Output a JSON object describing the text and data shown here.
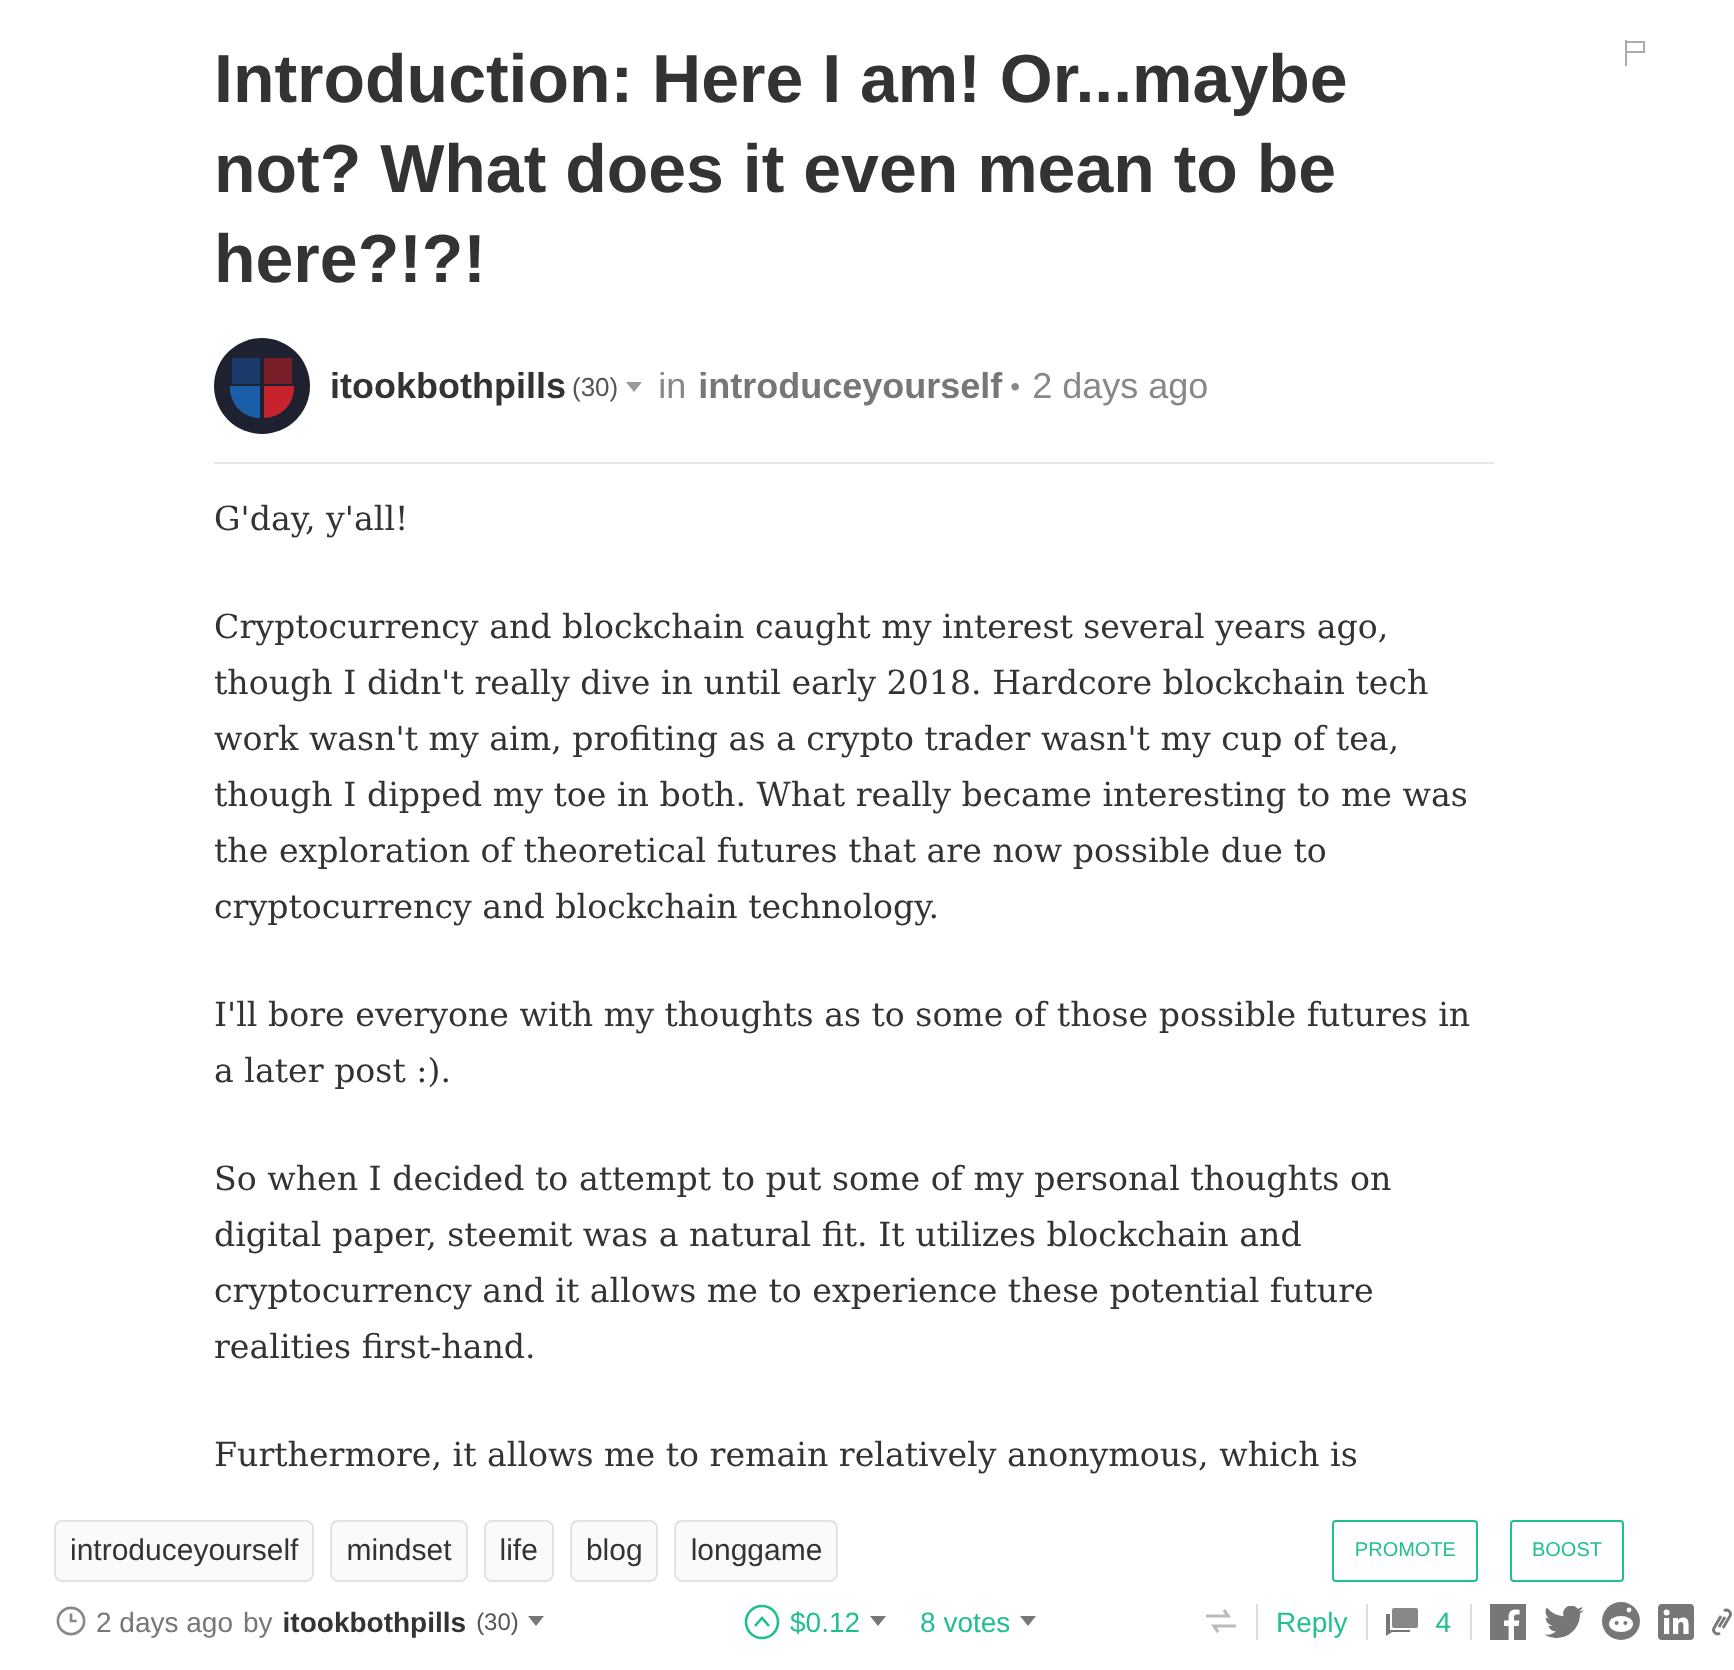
{
  "post": {
    "title": "Introduction: Here I am! Or...maybe not? What does it even mean to be here?!?!",
    "author": {
      "name": "itookbothpills",
      "reputation": "(30)"
    },
    "in_label": "in",
    "community": "introduceyourself",
    "separator": "•",
    "time": "2 days ago",
    "paragraphs": [
      {
        "text": "G'day, y'all!"
      },
      {
        "text": "Cryptocurrency and blockchain caught my interest several years ago, though I didn't really dive in until early 2018. Hardcore blockchain tech work wasn't my aim, profiting as a crypto trader wasn't my cup of tea, though I dipped my toe in both. What really became interesting to me was the exploration of theoretical futures that are now possible due to cryptocurrency and blockchain technology."
      },
      {
        "text": "I'll bore everyone with my thoughts as to some of those possible futures in a later post :)."
      },
      {
        "text": "So when I decided to attempt to put some of my personal thoughts on digital paper, steemit was a natural fit. It utilizes blockchain and cryptocurrency and it allows me to experience these potential future realities first-hand."
      },
      {
        "text": "Furthermore, it allows me to remain relatively anonymous, which is"
      }
    ]
  },
  "tags": [
    "introduceyourself",
    "mindset",
    "life",
    "blog",
    "longgame"
  ],
  "actions": [
    "PROMOTE",
    "BOOST"
  ],
  "footer": {
    "time": "2 days ago",
    "by": "by",
    "author": "itookbothpills",
    "reputation": "(30)",
    "payout": "$0.12",
    "votes": "8 votes",
    "reply": "Reply",
    "comments": "4"
  }
}
